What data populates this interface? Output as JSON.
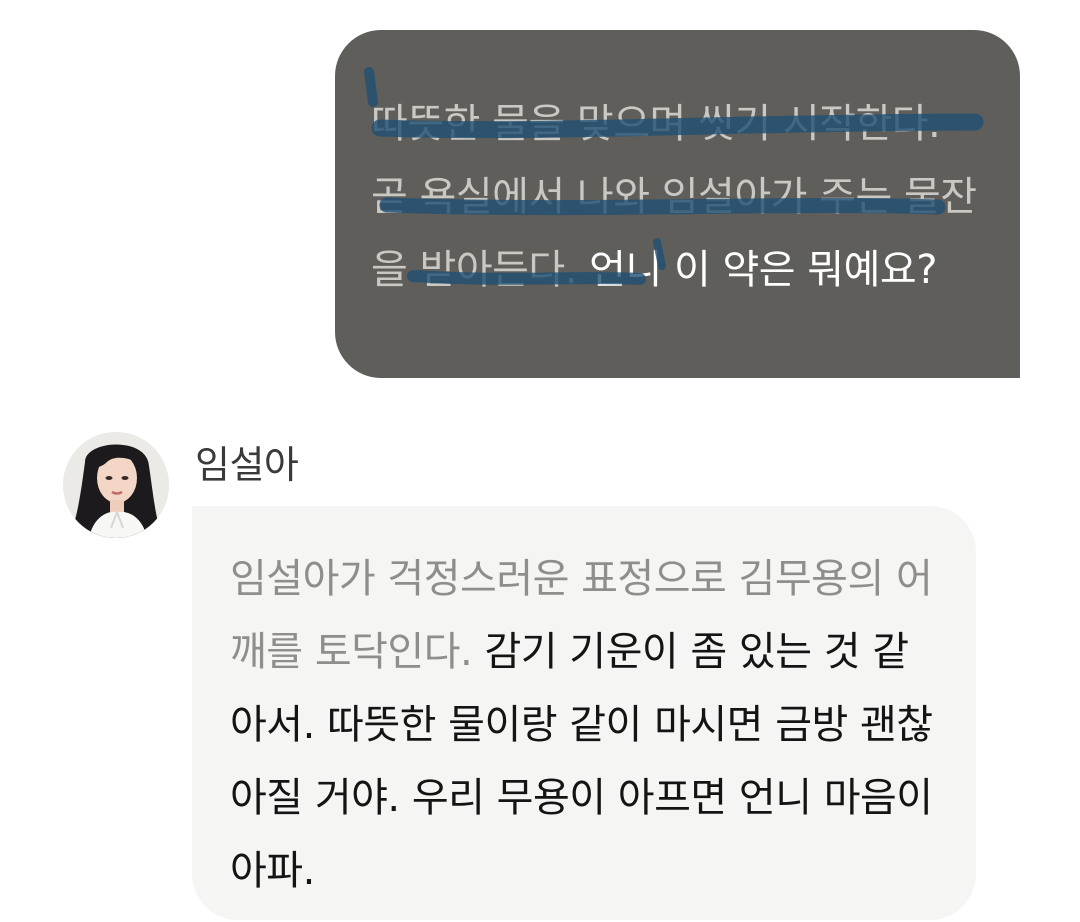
{
  "user_message": {
    "narration": "따뜻한 물을 맞으며 씻기 시작한다. 곧 욕실에서 나와 임설아가 주는 물잔을 받아든다.",
    "dialogue": "언니 이 약은 뭐예요?"
  },
  "character_message": {
    "sender_name": "임설아",
    "narration": "임설아가 걱정스러운 표정으로 김무용의 어깨를 토닥인다.",
    "dialogue": "감기 기운이 좀 있는 것 같아서. 따뜻한 물이랑 같이 마시면 금방 괜찮아질 거야. 우리 무용이 아프면 언니 마음이 아파."
  },
  "colors": {
    "user_bubble": "#5f5e5a",
    "character_bubble": "#f5f5f3",
    "highlighter": "#1f4f73"
  },
  "icons": {
    "avatar": "character-portrait"
  }
}
